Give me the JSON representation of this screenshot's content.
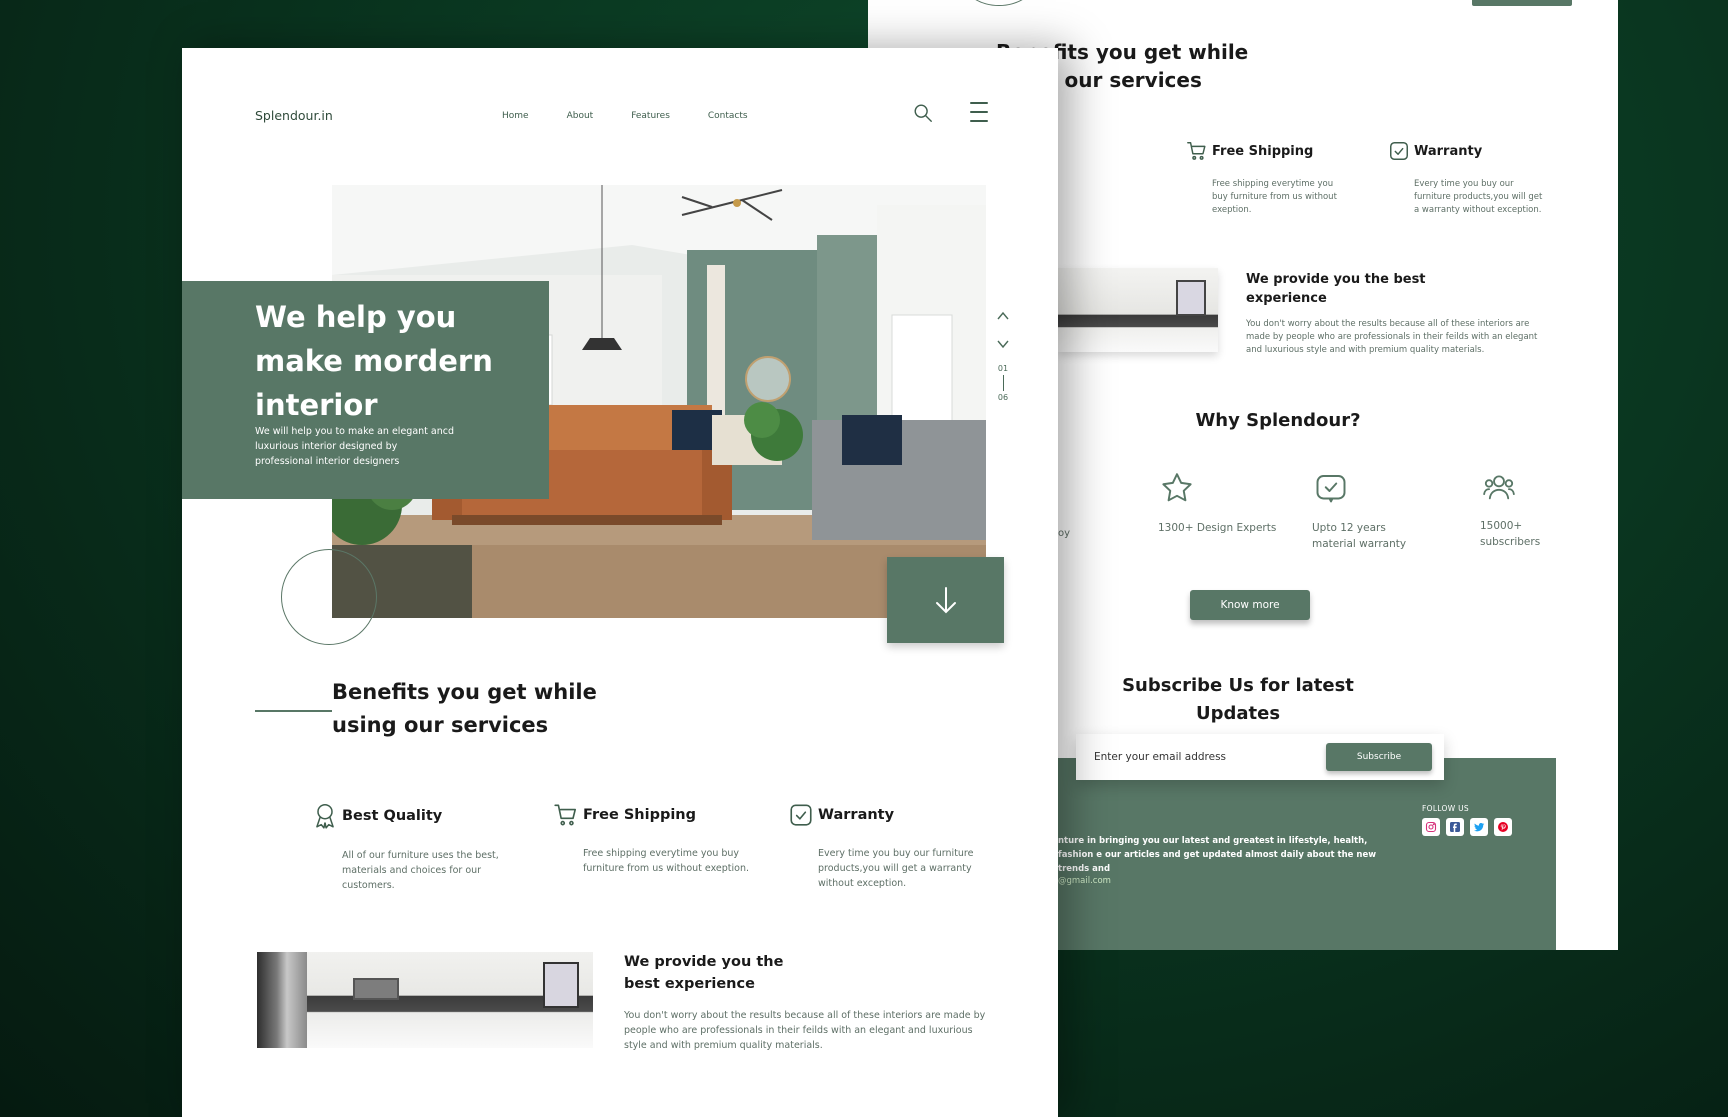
{
  "colors": {
    "accent": "#587766",
    "background": "#0a3620",
    "text_dark": "#1a1a1a",
    "text_muted": "#5e6f66"
  },
  "front": {
    "logo": "Splendour.in",
    "nav": [
      "Home",
      "About",
      "Features",
      "Contacts"
    ],
    "hero": {
      "title": "We help you make mordern interior",
      "subtitle": "We will help you to make an elegant ancd luxurious interior designed by professional interior designers"
    },
    "slider": {
      "current": "01",
      "total": "06"
    },
    "benefits_title": "Benefits you get while using our services",
    "features": [
      {
        "title": "Best Quality",
        "icon": "award-icon",
        "desc": "All of our furniture uses the best, materials and choices for our customers."
      },
      {
        "title": "Free Shipping",
        "icon": "cart-icon",
        "desc": "Free shipping everytime you buy furniture from us without exeption."
      },
      {
        "title": "Warranty",
        "icon": "check-badge-icon",
        "desc": "Every time you buy our furniture products,you will get a warranty without exception."
      }
    ],
    "experience": {
      "title": "We provide you the best experience",
      "body": "You don't worry about the results because all of these interiors are made by people who are professionals in their feilds with an elegant and luxurious style and with premium quality materials."
    }
  },
  "back": {
    "benefits_title": "Benefits you get while using our services",
    "features": [
      {
        "title": "Free Shipping",
        "desc": "Free shipping everytime you buy furniture from us without exeption."
      },
      {
        "title": "Warranty",
        "desc": "Every time you buy our furniture products,you will get a warranty without exception."
      }
    ],
    "experience": {
      "title": "We provide you the best experience",
      "body": "You don't worry about the results because all of these interiors are made by people who are professionals in their feilds with an elegant and luxurious style and with premium quality materials."
    },
    "why_title": "Why Splendour?",
    "stats": [
      {
        "label": "1300+ Design Experts",
        "icon": "star-icon"
      },
      {
        "label": "Upto 12 years material warranty",
        "icon": "check-badge-icon"
      },
      {
        "label": "15000+ subscribers",
        "icon": "users-icon"
      }
    ],
    "stat_cut": "oy",
    "know_more": "Know more",
    "subscribe_title": "Subscribe Us for latest Updates",
    "email_placeholder": "Enter your email address",
    "subscribe_button": "Subscribe",
    "footer": {
      "text": "nture in bringing you our latest and greatest in lifestyle, health, fashion e our articles and get updated almost daily about the new trends and",
      "email": "@gmail.com",
      "follow_label": "FOLLOW US",
      "socials": [
        "instagram-icon",
        "facebook-icon",
        "twitter-icon",
        "pinterest-icon"
      ]
    }
  }
}
